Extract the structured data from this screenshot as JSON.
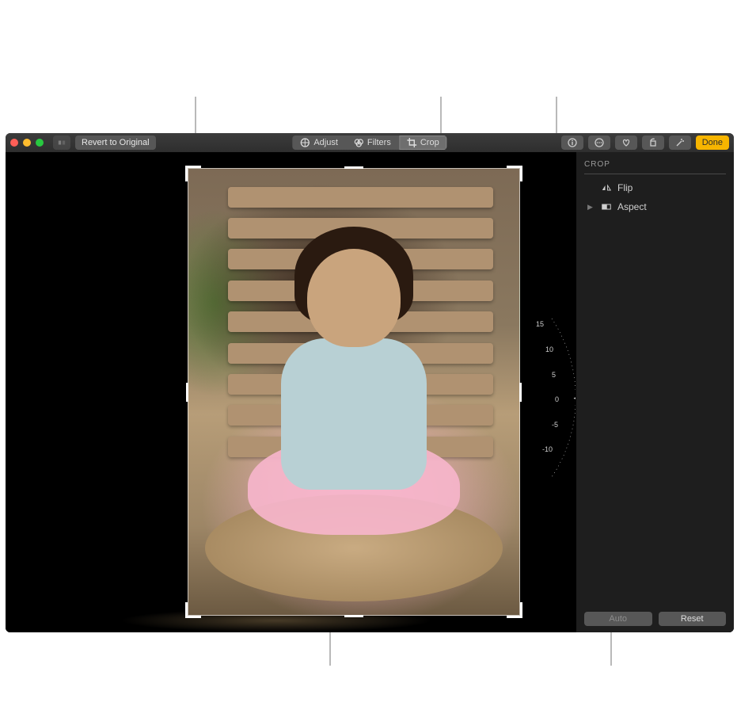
{
  "toolbar": {
    "revert_label": "Revert to Original",
    "tabs": {
      "adjust": "Adjust",
      "filters": "Filters",
      "crop": "Crop"
    },
    "done_label": "Done"
  },
  "panel": {
    "title": "CROP",
    "flip_label": "Flip",
    "aspect_label": "Aspect",
    "auto_label": "Auto",
    "reset_label": "Reset"
  },
  "dial": {
    "ticks": [
      "15",
      "10",
      "5",
      "0",
      "-5",
      "-10"
    ]
  }
}
